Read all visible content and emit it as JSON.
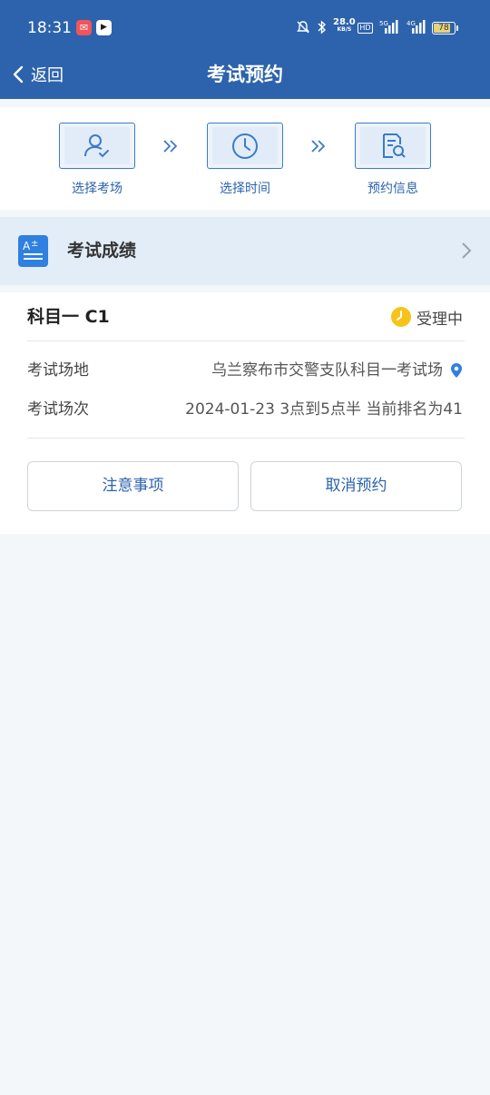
{
  "status_bar": {
    "time": "18:31",
    "net_speed_value": "28.0",
    "net_speed_unit": "KB/S",
    "hd_label": "HD",
    "signal1_label": "5G",
    "signal2_label": "4G",
    "battery": "78"
  },
  "nav": {
    "back_label": "返回",
    "title": "考试预约"
  },
  "steps": [
    {
      "label": "选择考场",
      "icon": "user-check-icon"
    },
    {
      "label": "选择时间",
      "icon": "clock-icon"
    },
    {
      "label": "预约信息",
      "icon": "document-search-icon"
    }
  ],
  "score": {
    "title": "考试成绩",
    "icon": "grades-icon"
  },
  "booking": {
    "subject": "科目一 C1",
    "status": "受理中",
    "venue_label": "考试场地",
    "venue_value": "乌兰察布市交警支队科目一考试场",
    "session_label": "考试场次",
    "session_value": "2024-01-23 3点到5点半 当前排名为41"
  },
  "actions": {
    "notes_label": "注意事项",
    "cancel_label": "取消预约"
  },
  "colors": {
    "header_bg": "#2c63ac",
    "accent": "#2f80e0",
    "status_yellow": "#f7c31a"
  }
}
